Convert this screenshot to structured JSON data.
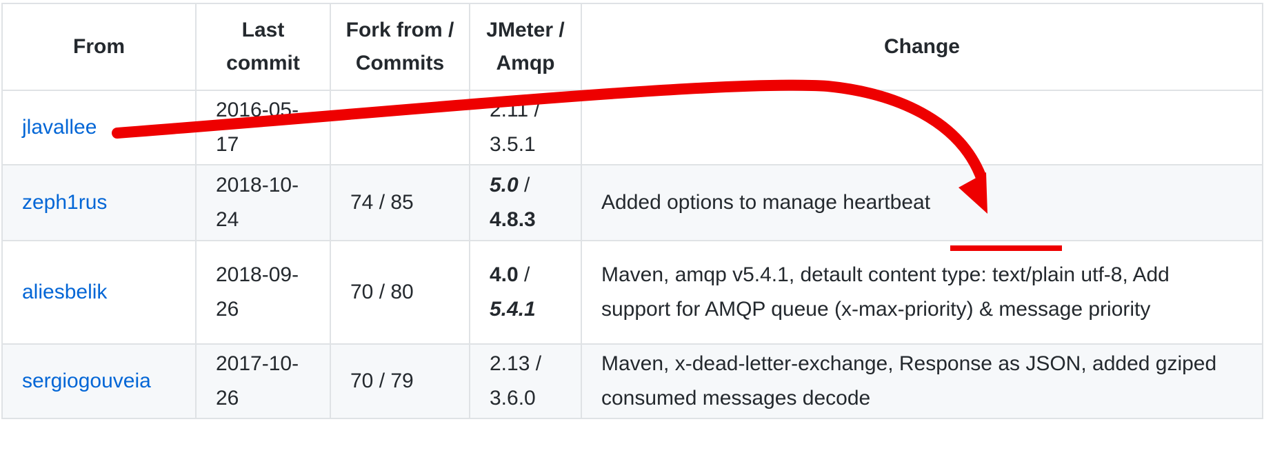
{
  "headers": {
    "from": "From",
    "last_commit": "Last commit",
    "fork_commits": "Fork from / Commits",
    "jmeter_amqp": "JMeter / Amqp",
    "change": "Change"
  },
  "rows": [
    {
      "from": "jlavallee",
      "last_commit": "2016-05-17",
      "fork_commits": "",
      "jmeter": "2.11",
      "amqp": "3.5.1",
      "change": ""
    },
    {
      "from": "zeph1rus",
      "last_commit": "2018-10-24",
      "fork_commits": "74 / 85",
      "jmeter": "5.0",
      "amqp": "4.8.3",
      "change": "Added options to manage heartbeat"
    },
    {
      "from": "aliesbelik",
      "last_commit": "2018-09-26",
      "fork_commits": "70 / 80",
      "jmeter": "4.0",
      "amqp": "5.4.1",
      "change": "Maven, amqp v5.4.1, detault content type: text/plain utf-8, Add support for AMQP queue (x-max-priority) & message priority"
    },
    {
      "from": "sergiogouveia",
      "last_commit": "2017-10-26",
      "fork_commits": "70 / 79",
      "jmeter": "2.13",
      "amqp": "3.6.0",
      "change": "Maven, x-dead-letter-exchange, Response as JSON, added gziped consumed messages decode"
    }
  ],
  "annotation_color": "#ee0000",
  "link_color": "#0366d6"
}
